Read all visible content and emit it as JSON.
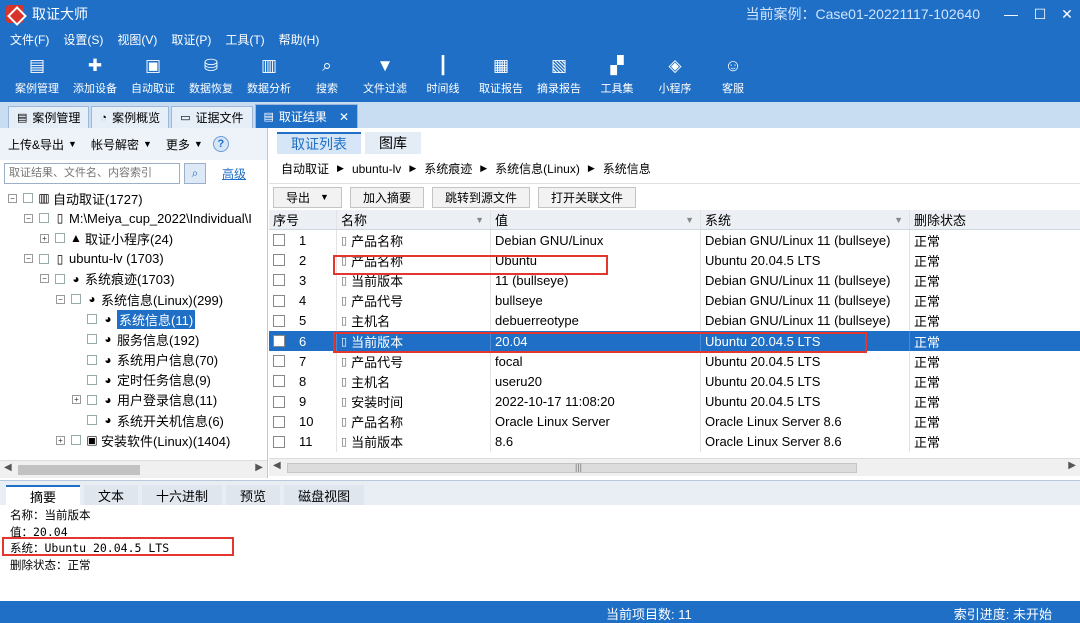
{
  "titlebar": {
    "app_title": "取证大师",
    "case_title": "当前案例：Case01-20221117-102640",
    "minimize": "—",
    "maximize": "☐",
    "close": "✕"
  },
  "menu": [
    "文件(F)",
    "设置(S)",
    "视图(V)",
    "取证(P)",
    "工具(T)",
    "帮助(H)"
  ],
  "toolbar": [
    {
      "label": "案例管理",
      "icon": "case-management-icon",
      "glyph": "▤"
    },
    {
      "label": "添加设备",
      "icon": "add-device-icon",
      "glyph": "✚"
    },
    {
      "label": "自动取证",
      "icon": "auto-forensics-icon",
      "glyph": "▣"
    },
    {
      "label": "数据恢复",
      "icon": "data-recovery-icon",
      "glyph": "⛁"
    },
    {
      "label": "数据分析",
      "icon": "data-analysis-icon",
      "glyph": "▥"
    },
    {
      "label": "搜索",
      "icon": "search-icon",
      "glyph": "⌕"
    },
    {
      "label": "文件过滤",
      "icon": "file-filter-icon",
      "glyph": "▼"
    },
    {
      "label": "时间线",
      "icon": "timeline-icon",
      "glyph": "┃"
    },
    {
      "label": "取证报告",
      "icon": "forensic-report-icon",
      "glyph": "▦"
    },
    {
      "label": "摘录报告",
      "icon": "excerpt-report-icon",
      "glyph": "▧"
    },
    {
      "label": "工具集",
      "icon": "toolset-icon",
      "glyph": "▞"
    },
    {
      "label": "小程序",
      "icon": "mini-program-icon",
      "glyph": "◈"
    },
    {
      "label": "客服",
      "icon": "customer-service-icon",
      "glyph": "☺"
    }
  ],
  "doc_tabs": [
    {
      "label": "案例管理",
      "icon": "case-tab-icon",
      "glyph": "▤",
      "active": false
    },
    {
      "label": "案例概览",
      "icon": "overview-tab-icon",
      "glyph": "◔",
      "active": false
    },
    {
      "label": "证据文件",
      "icon": "evidence-tab-icon",
      "glyph": "▭",
      "active": false
    },
    {
      "label": "取证结果",
      "icon": "result-tab-icon",
      "glyph": "▤",
      "active": true
    }
  ],
  "doc_tab_close": "✕",
  "left": {
    "tools": [
      "上传&导出",
      "帐号解密",
      "更多"
    ],
    "help": "?",
    "search_placeholder": "取证结果、文件名、内容索引",
    "advanced": "高级",
    "tree": [
      {
        "level": 0,
        "exp": "⊟",
        "icon": "▥",
        "label": "自动取证(1727)",
        "selected": false
      },
      {
        "level": 1,
        "exp": "⊟",
        "icon": "▯",
        "label": "M:\\Meiya_cup_2022\\Individual\\I",
        "selected": false
      },
      {
        "level": 2,
        "exp": "⊞",
        "icon": "▲",
        "label": "取证小程序(24)",
        "selected": false
      },
      {
        "level": 1,
        "exp": "⊟",
        "icon": "▯",
        "label": "ubuntu-lv (1703)",
        "selected": false
      },
      {
        "level": 2,
        "exp": "⊟",
        "icon": "◕",
        "label": "系统痕迹(1703)",
        "selected": false
      },
      {
        "level": 3,
        "exp": "⊟",
        "icon": "◕",
        "label": "系统信息(Linux)(299)",
        "selected": false
      },
      {
        "level": 4,
        "exp": "",
        "icon": "◕",
        "label": "系统信息(11)",
        "selected": true
      },
      {
        "level": 4,
        "exp": "",
        "icon": "◕",
        "label": "服务信息(192)",
        "selected": false
      },
      {
        "level": 4,
        "exp": "",
        "icon": "◕",
        "label": "系统用户信息(70)",
        "selected": false
      },
      {
        "level": 4,
        "exp": "",
        "icon": "◕",
        "label": "定时任务信息(9)",
        "selected": false
      },
      {
        "level": 4,
        "exp": "⊞",
        "icon": "◕",
        "label": "用户登录信息(11)",
        "selected": false
      },
      {
        "level": 4,
        "exp": "",
        "icon": "◕",
        "label": "系统开关机信息(6)",
        "selected": false
      },
      {
        "level": 3,
        "exp": "⊞",
        "icon": "▣",
        "label": "安装软件(Linux)(1404)",
        "selected": false
      }
    ]
  },
  "right": {
    "tabs": [
      {
        "label": "取证列表",
        "active": true
      },
      {
        "label": "图库",
        "active": false
      }
    ],
    "breadcrumb": [
      "自动取证",
      "ubuntu-lv",
      "系统痕迹",
      "系统信息(Linux)",
      "系统信息"
    ],
    "actions": [
      {
        "label": "导出",
        "dropdown": true
      },
      {
        "label": "加入摘要",
        "dropdown": false
      },
      {
        "label": "跳转到源文件",
        "dropdown": false
      },
      {
        "label": "打开关联文件",
        "dropdown": false
      }
    ],
    "columns": [
      "序号",
      "名称",
      "值",
      "系统",
      "删除状态"
    ],
    "rows": [
      {
        "no": "1",
        "name": "产品名称",
        "value": "Debian GNU/Linux",
        "system": "Debian GNU/Linux 11 (bullseye)",
        "status": "正常",
        "selected": false
      },
      {
        "no": "2",
        "name": "产品名称",
        "value": "Ubuntu",
        "system": "Ubuntu 20.04.5 LTS",
        "status": "正常",
        "selected": false
      },
      {
        "no": "3",
        "name": "当前版本",
        "value": "11 (bullseye)",
        "system": "Debian GNU/Linux 11 (bullseye)",
        "status": "正常",
        "selected": false
      },
      {
        "no": "4",
        "name": "产品代号",
        "value": "bullseye",
        "system": "Debian GNU/Linux 11 (bullseye)",
        "status": "正常",
        "selected": false
      },
      {
        "no": "5",
        "name": "主机名",
        "value": "debuerreotype",
        "system": "Debian GNU/Linux 11 (bullseye)",
        "status": "正常",
        "selected": false
      },
      {
        "no": "6",
        "name": "当前版本",
        "value": "20.04",
        "system": "Ubuntu 20.04.5 LTS",
        "status": "正常",
        "selected": true
      },
      {
        "no": "7",
        "name": "产品代号",
        "value": "focal",
        "system": "Ubuntu 20.04.5 LTS",
        "status": "正常",
        "selected": false
      },
      {
        "no": "8",
        "name": "主机名",
        "value": "useru20",
        "system": "Ubuntu 20.04.5 LTS",
        "status": "正常",
        "selected": false
      },
      {
        "no": "9",
        "name": "安装时间",
        "value": "2022-10-17 11:08:20",
        "system": "Ubuntu 20.04.5 LTS",
        "status": "正常",
        "selected": false
      },
      {
        "no": "10",
        "name": "产品名称",
        "value": "Oracle Linux Server",
        "system": "Oracle Linux Server 8.6",
        "status": "正常",
        "selected": false
      },
      {
        "no": "11",
        "name": "当前版本",
        "value": "8.6",
        "system": "Oracle Linux Server 8.6",
        "status": "正常",
        "selected": false
      }
    ]
  },
  "bottom": {
    "tabs": [
      {
        "label": "摘要",
        "active": true
      },
      {
        "label": "文本",
        "active": false
      },
      {
        "label": "十六进制",
        "active": false
      },
      {
        "label": "预览",
        "active": false
      },
      {
        "label": "磁盘视图",
        "active": false
      }
    ],
    "details": [
      "名称：当前版本",
      "值：20.04",
      "系统：Ubuntu 20.04.5 LTS",
      "删除状态：正常"
    ]
  },
  "status": {
    "count": "当前项目数: 11",
    "index": "索引进度: 未开始"
  },
  "colors": {
    "accent": "#1f6fc6",
    "highlight": "#e2362f"
  }
}
